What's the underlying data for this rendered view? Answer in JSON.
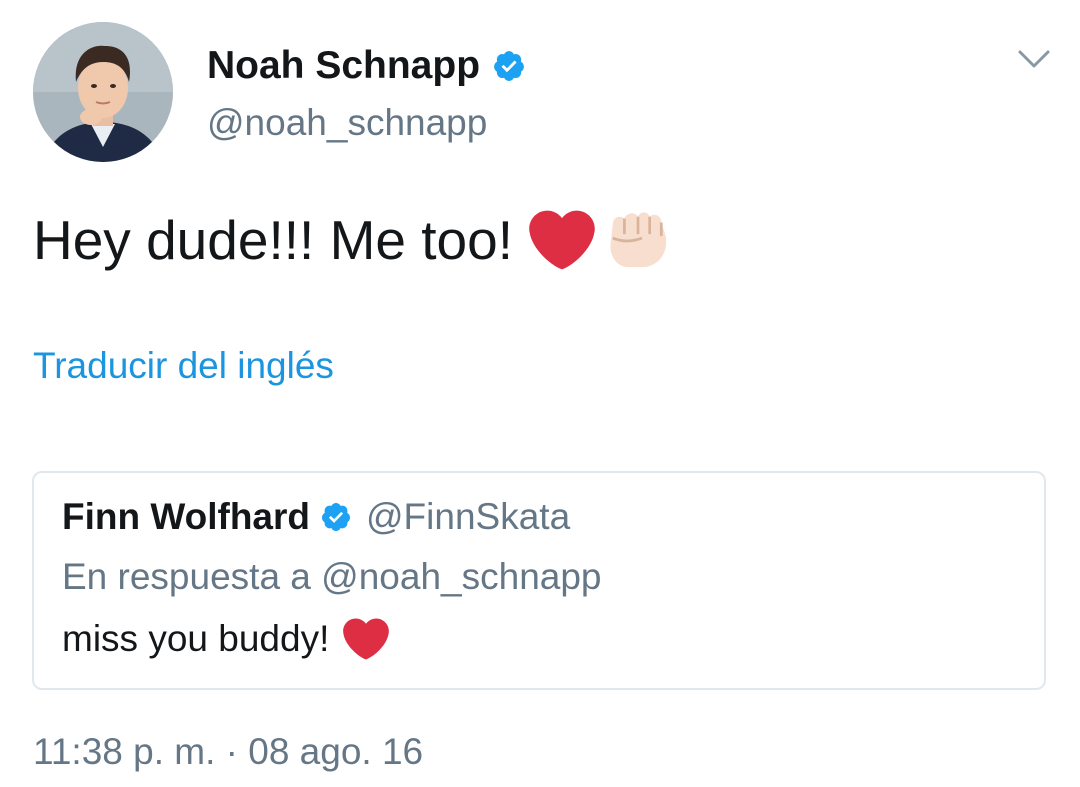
{
  "author": {
    "display_name": "Noah Schnapp",
    "handle": "@noah_schnapp",
    "verified": true,
    "avatar_icon": "avatar-photo"
  },
  "menu": {
    "icon": "chevron-down-icon"
  },
  "tweet": {
    "text": "Hey dude!!! Me too!",
    "emojis": [
      "heart-emoji",
      "fist-emoji"
    ]
  },
  "translate": {
    "label": "Traducir del inglés"
  },
  "quoted_tweet": {
    "display_name": "Finn Wolfhard",
    "handle": "@FinnSkata",
    "verified": true,
    "reply_to": "En respuesta a @noah_schnapp",
    "text": "miss you buddy!",
    "emojis": [
      "heart-emoji"
    ]
  },
  "timestamp": "11:38 p. m. · 08 ago. 16",
  "colors": {
    "verified_blue": "#1da1f2",
    "link_blue": "#1b95e0",
    "secondary_gray": "#657786",
    "heart_red": "#dd2e44",
    "fist_skin": "#f7dece"
  }
}
